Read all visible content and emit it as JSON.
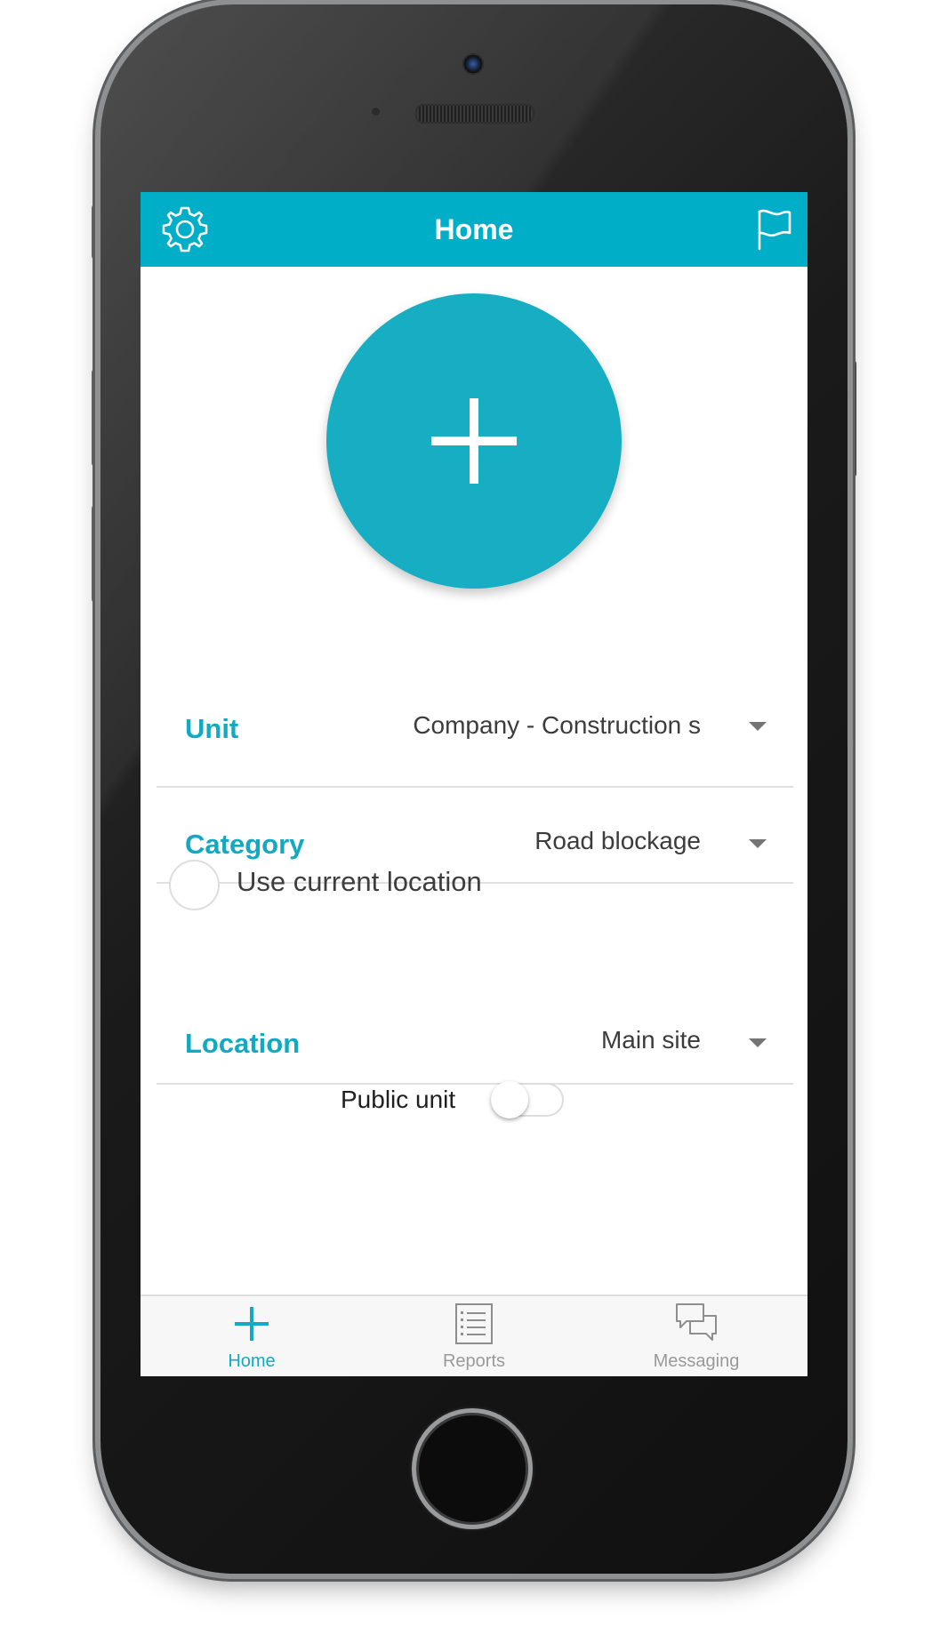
{
  "colors": {
    "accent": "#00aec7",
    "fab": "#17adc3",
    "label_teal": "#12a9c1",
    "tab_inactive": "#9a9a9a"
  },
  "header": {
    "title": "Home",
    "left_icon": "gear-icon",
    "right_icon": "flag-icon"
  },
  "main": {
    "add_button_icon": "plus-icon",
    "unit": {
      "label": "Unit",
      "value": "Company - Construction s"
    },
    "category": {
      "label": "Category",
      "value": "Road blockage"
    },
    "use_current_location": {
      "label": "Use current location",
      "checked": false
    },
    "location": {
      "label": "Location",
      "value": "Main site"
    },
    "public_unit": {
      "label": "Public unit",
      "on": false
    }
  },
  "tabs": [
    {
      "label": "Home",
      "icon": "plus-icon",
      "active": true
    },
    {
      "label": "Reports",
      "icon": "list-icon",
      "active": false
    },
    {
      "label": "Messaging",
      "icon": "chat-icon",
      "active": false
    }
  ]
}
